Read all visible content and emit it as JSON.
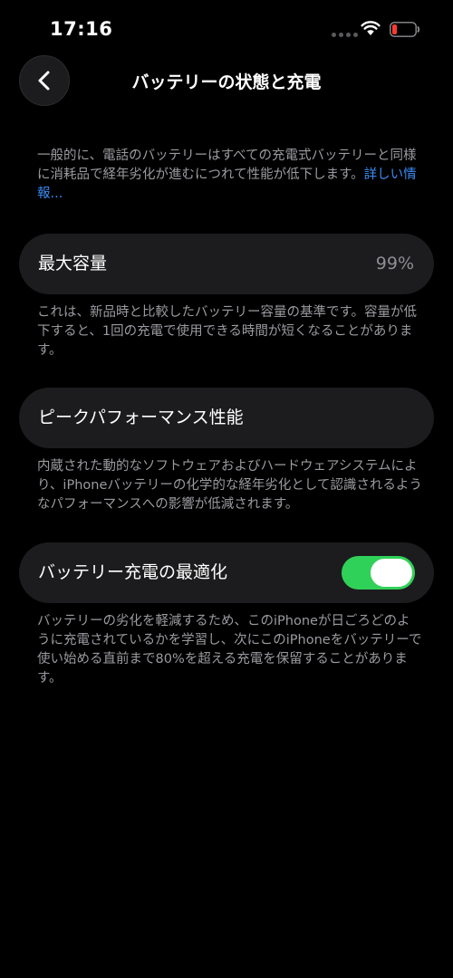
{
  "status_bar": {
    "time": "17:16"
  },
  "nav": {
    "title": "バッテリーの状態と充電"
  },
  "intro": {
    "text": "一般的に、電話のバッテリーはすべての充電式バッテリーと同様に消耗品で経年劣化が進むにつれて性能が低下します。",
    "link": "詳しい情報..."
  },
  "max_capacity": {
    "label": "最大容量",
    "value": "99%",
    "description": "これは、新品時と比較したバッテリー容量の基準です。容量が低下すると、1回の充電で使用できる時間が短くなることがあります。"
  },
  "peak_performance": {
    "label": "ピークパフォーマンス性能",
    "description": "内蔵された動的なソフトウェアおよびハードウェアシステムにより、iPhoneバッテリーの化学的な経年劣化として認識されるようなパフォーマンスへの影響が低減されます。"
  },
  "optimized_charging": {
    "label": "バッテリー充電の最適化",
    "enabled": true,
    "description": "バッテリーの劣化を軽減するため、このiPhoneが日ごろどのように充電されているかを学習し、次にこのiPhoneをバッテリーで使い始める直前まで80%を超える充電を保留することがあります。"
  },
  "colors": {
    "background": "#000000",
    "card": "#1c1c1e",
    "toggle_on": "#30d158",
    "link": "#3a8cf5",
    "battery_low": "#ff3b30"
  }
}
